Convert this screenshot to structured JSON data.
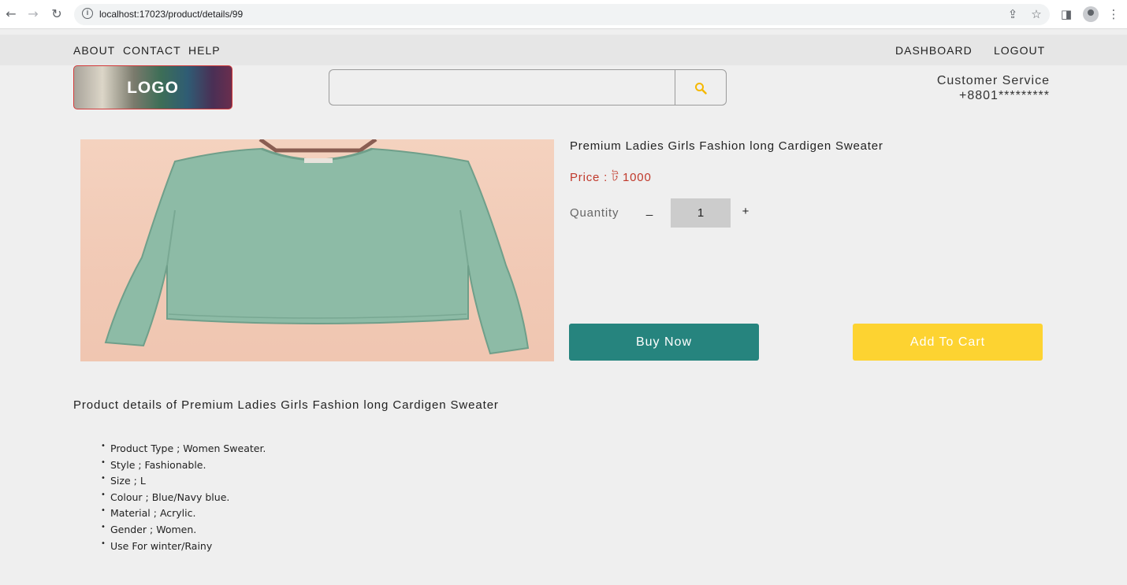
{
  "browser": {
    "url": "localhost:17023/product/details/99"
  },
  "topnav": {
    "left": [
      "ABOUT",
      "CONTACT",
      "HELP"
    ],
    "right": [
      "DASHBOARD",
      "LOGOUT"
    ]
  },
  "header": {
    "logo": "LOGO",
    "search_value": "",
    "customer_service_label": "Customer Service",
    "customer_service_phone": "+8801*********"
  },
  "product": {
    "title": "Premium Ladies Girls Fashion long Cardigen Sweater",
    "price": "Price : ট 1000",
    "quantity_label": "Quantity",
    "quantity_minus": "_",
    "quantity_value": "1",
    "quantity_plus": "+",
    "buy_now": "Buy Now",
    "add_to_cart": "Add To Cart"
  },
  "details": {
    "heading": "Product details of Premium Ladies Girls Fashion long Cardigen Sweater",
    "items": [
      "Product Type ; Women Sweater.",
      "Style ; Fashionable.",
      "Size ; L",
      "Colour ; Blue/Navy blue.",
      "Material ; Acrylic.",
      "Gender ; Women.",
      "Use For winter/Rainy"
    ]
  },
  "colors": {
    "buy_button": "#26847e",
    "cart_button": "#fdd331",
    "price_text": "#c0392b",
    "sweater": "#8dbba6"
  }
}
